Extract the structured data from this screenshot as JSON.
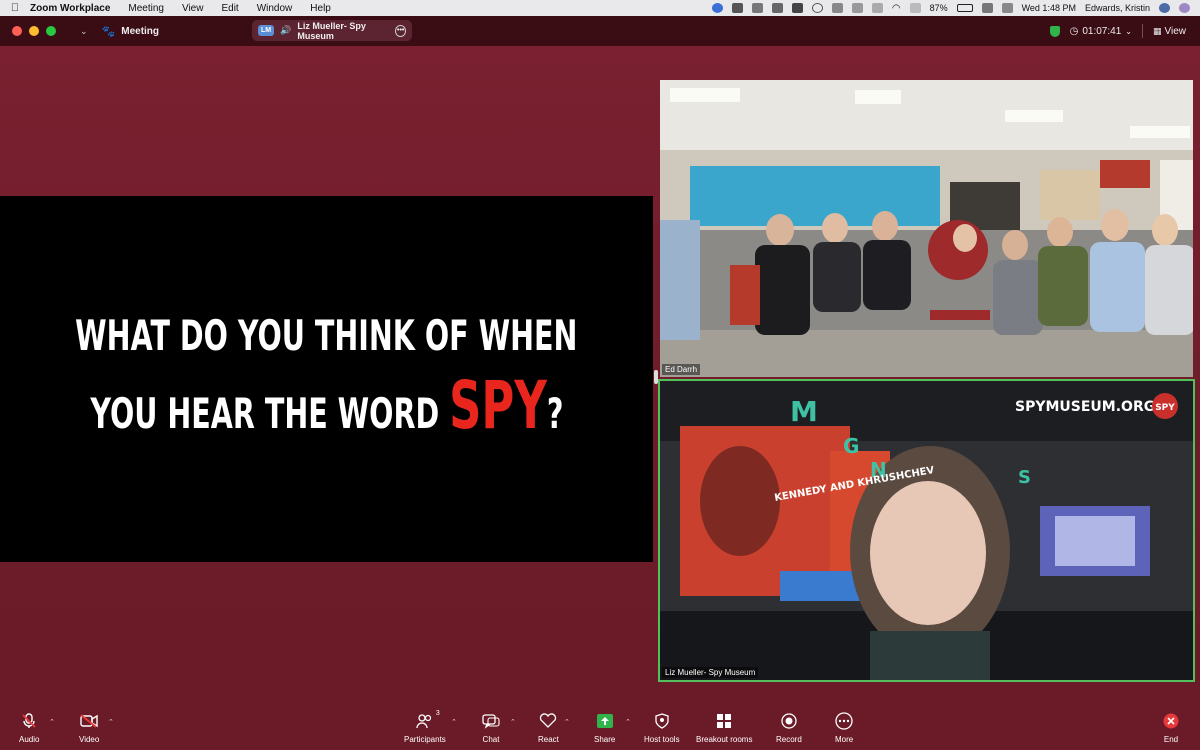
{
  "menubar": {
    "apple_icon": "apple-icon",
    "items": [
      "Zoom Workplace",
      "Meeting",
      "View",
      "Edit",
      "Window",
      "Help"
    ],
    "battery": "87%",
    "clock": "Wed 1:48 PM",
    "user": "Edwards, Kristin"
  },
  "titlebar": {
    "meeting_label": "Meeting",
    "speaker_badge": "LM",
    "speaker_name": "Liz Mueller- Spy Museum",
    "timer": "01:07:41",
    "view_label": "View"
  },
  "slide": {
    "line1": "WHAT DO YOU THINK OF WHEN",
    "line2_prefix": "YOU HEAR THE WORD ",
    "line2_highlight": "SPY",
    "line2_suffix": "?"
  },
  "videos": [
    {
      "name": "Ed Darrh"
    },
    {
      "name": "Liz Mueller- Spy Museum",
      "backdrop_text": "SPYMUSEUM.ORG",
      "logo_text": "SPY",
      "exhibit_title": "KENNEDY AND KHRUSHCHEV",
      "letters": [
        "M",
        "G",
        "N",
        "S"
      ]
    }
  ],
  "toolbar": {
    "audio": "Audio",
    "video": "Video",
    "participants": "Participants",
    "participants_count": "3",
    "chat": "Chat",
    "react": "React",
    "share": "Share",
    "host_tools": "Host tools",
    "breakout": "Breakout rooms",
    "record": "Record",
    "more": "More",
    "end": "End"
  },
  "colors": {
    "background": "#6a1d28",
    "spy_red": "#e8261e",
    "active_speaker": "#53c05c",
    "share_green": "#2fb34a",
    "end_red": "#e5393a"
  }
}
